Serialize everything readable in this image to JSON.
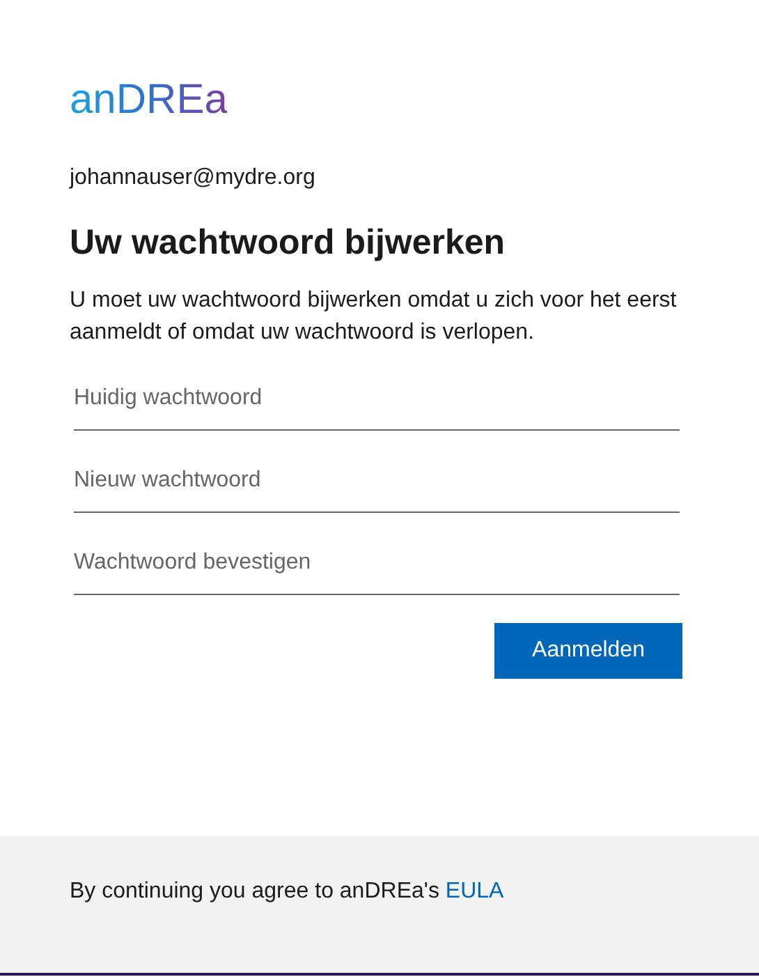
{
  "logo": "anDREa",
  "email": "johannauser@mydre.org",
  "title": "Uw wachtwoord bijwerken",
  "description": "U moet uw wachtwoord bijwerken omdat u zich voor het eerst aanmeldt of omdat uw wachtwoord is verlopen.",
  "fields": [
    {
      "placeholder": "Huidig wachtwoord"
    },
    {
      "placeholder": "Nieuw wachtwoord"
    },
    {
      "placeholder": "Wachtwoord bevestigen"
    }
  ],
  "submit": "Aanmelden",
  "footer": {
    "text": "By continuing you agree to anDREa's ",
    "link": "EULA"
  }
}
